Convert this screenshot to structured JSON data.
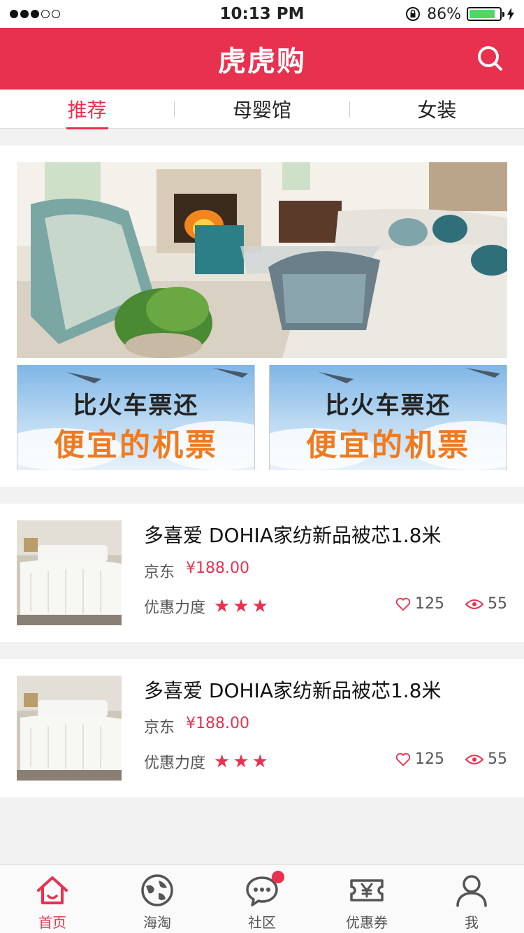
{
  "status_bar": {
    "time": "10:13 PM",
    "battery_percent": "86%",
    "battery_level": 0.86,
    "signal_dots": [
      true,
      true,
      true,
      false,
      false
    ]
  },
  "header": {
    "title": "虎虎购",
    "search_icon": "search-icon"
  },
  "tabs": [
    {
      "label": "推荐",
      "active": true
    },
    {
      "label": "母婴馆",
      "active": false
    },
    {
      "label": "女装",
      "active": false
    }
  ],
  "promos": [
    {
      "line1": "比火车票还",
      "line2": "便宜的机票"
    },
    {
      "line1": "比火车票还",
      "line2": "便宜的机票"
    }
  ],
  "products": [
    {
      "title": "多喜爱 DOHIA家纺新品被芯1.8米",
      "store": "京东",
      "price": "¥188.00",
      "discount_label": "优惠力度",
      "stars": 3,
      "likes": "125",
      "views": "55"
    },
    {
      "title": "多喜爱 DOHIA家纺新品被芯1.8米",
      "store": "京东",
      "price": "¥188.00",
      "discount_label": "优惠力度",
      "stars": 3,
      "likes": "125",
      "views": "55"
    }
  ],
  "bottom_nav": [
    {
      "label": "首页",
      "icon": "home-icon",
      "active": true
    },
    {
      "label": "海淘",
      "icon": "globe-icon",
      "active": false
    },
    {
      "label": "社区",
      "icon": "chat-icon",
      "active": false,
      "badge": true
    },
    {
      "label": "优惠券",
      "icon": "coupon-icon",
      "active": false
    },
    {
      "label": "我",
      "icon": "user-icon",
      "active": false
    }
  ],
  "colors": {
    "brand": "#e8314f",
    "promo_orange": "#f07a1e"
  }
}
